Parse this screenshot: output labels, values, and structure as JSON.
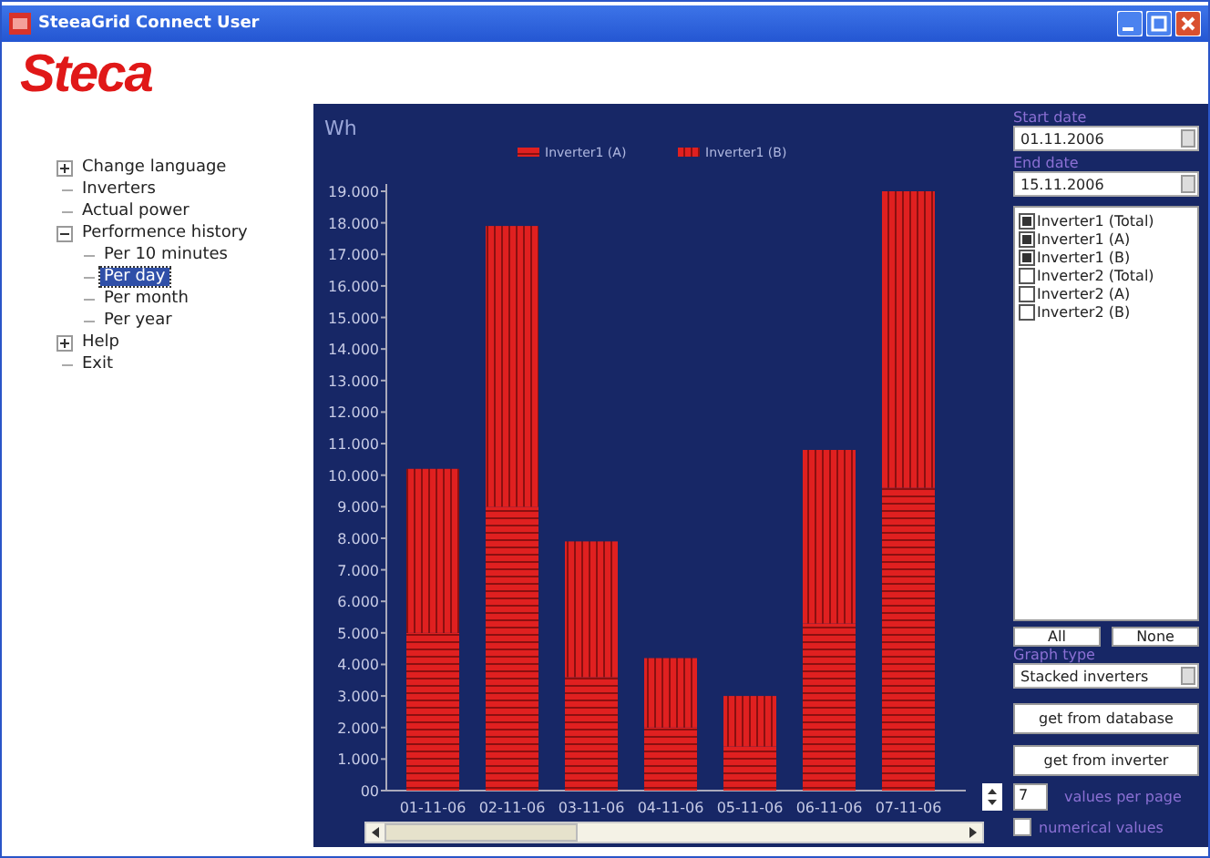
{
  "window": {
    "title": "SteeaGrid Connect User"
  },
  "logo": {
    "text": "Steca"
  },
  "nav_tree": [
    {
      "label": "Change language",
      "expanded": false,
      "selected": false
    },
    {
      "label": "Inverters",
      "selected": false
    },
    {
      "label": "Actual power",
      "selected": false
    },
    {
      "label": "Performence history",
      "expanded": true,
      "selected": false,
      "children": [
        {
          "label": "Per 10 minutes",
          "selected": false
        },
        {
          "label": "Per day",
          "selected": true
        },
        {
          "label": "Per month",
          "selected": false
        },
        {
          "label": "Per year",
          "selected": false
        }
      ]
    },
    {
      "label": "Help",
      "expanded": false,
      "selected": false
    },
    {
      "label": "Exit",
      "selected": false
    }
  ],
  "chart": {
    "chart_data": {
      "type": "bar",
      "stacked": true,
      "ylabel": "Wh",
      "legend": true,
      "categories": [
        "01-11-06",
        "02-11-06",
        "03-11-06",
        "04-11-06",
        "05-11-06",
        "06-11-06",
        "07-11-06"
      ],
      "series": [
        {
          "name": "Inverter1 (A)",
          "color": "#e02020",
          "values": [
            5000,
            9000,
            3600,
            2000,
            1400,
            5300,
            9600
          ]
        },
        {
          "name": "Inverter1 (B)",
          "color": "#e02020",
          "values": [
            5200,
            8900,
            4300,
            2200,
            1600,
            5500,
            9400
          ]
        }
      ],
      "ylim": [
        0,
        19000
      ],
      "yticks": [
        {
          "value": 0,
          "label": "00"
        },
        {
          "value": 1000,
          "label": "1.000"
        },
        {
          "value": 2000,
          "label": "2.000"
        },
        {
          "value": 3000,
          "label": "3.000"
        },
        {
          "value": 4000,
          "label": "4.000"
        },
        {
          "value": 5000,
          "label": "5.000"
        },
        {
          "value": 6000,
          "label": "6.000"
        },
        {
          "value": 7000,
          "label": "7.000"
        },
        {
          "value": 8000,
          "label": "8.000"
        },
        {
          "value": 9000,
          "label": "9.000"
        },
        {
          "value": 10000,
          "label": "10.000"
        },
        {
          "value": 11000,
          "label": "11.000"
        },
        {
          "value": 12000,
          "label": "12.000"
        },
        {
          "value": 13000,
          "label": "13.000"
        },
        {
          "value": 14000,
          "label": "14.000"
        },
        {
          "value": 15000,
          "label": "15.000"
        },
        {
          "value": 16000,
          "label": "16.000"
        },
        {
          "value": 17000,
          "label": "17.000"
        },
        {
          "value": 18000,
          "label": "18.000"
        },
        {
          "value": 19000,
          "label": "19.000"
        }
      ]
    }
  },
  "controls": {
    "start_date": {
      "label": "Start date",
      "value": "01.11.2006"
    },
    "end_date": {
      "label": "End date",
      "value": "15.11.2006"
    },
    "inverters": [
      {
        "label": "Inverter1 (Total)",
        "checked": true
      },
      {
        "label": "Inverter1 (A)",
        "checked": true
      },
      {
        "label": "Inverter1 (B)",
        "checked": true
      },
      {
        "label": "Inverter2 (Total)",
        "checked": false
      },
      {
        "label": "Inverter2 (A)",
        "checked": false
      },
      {
        "label": "Inverter2 (B)",
        "checked": false
      }
    ],
    "select_buttons": [
      "All",
      "None"
    ],
    "graph_type": {
      "label": "Graph type",
      "value": "Stacked inverters"
    },
    "action_buttons": [
      "get from database",
      "get from inverter"
    ],
    "values_per_page": {
      "value": "7",
      "label": "values per page"
    },
    "numerical_values": {
      "label": "numerical values",
      "checked": false
    }
  }
}
